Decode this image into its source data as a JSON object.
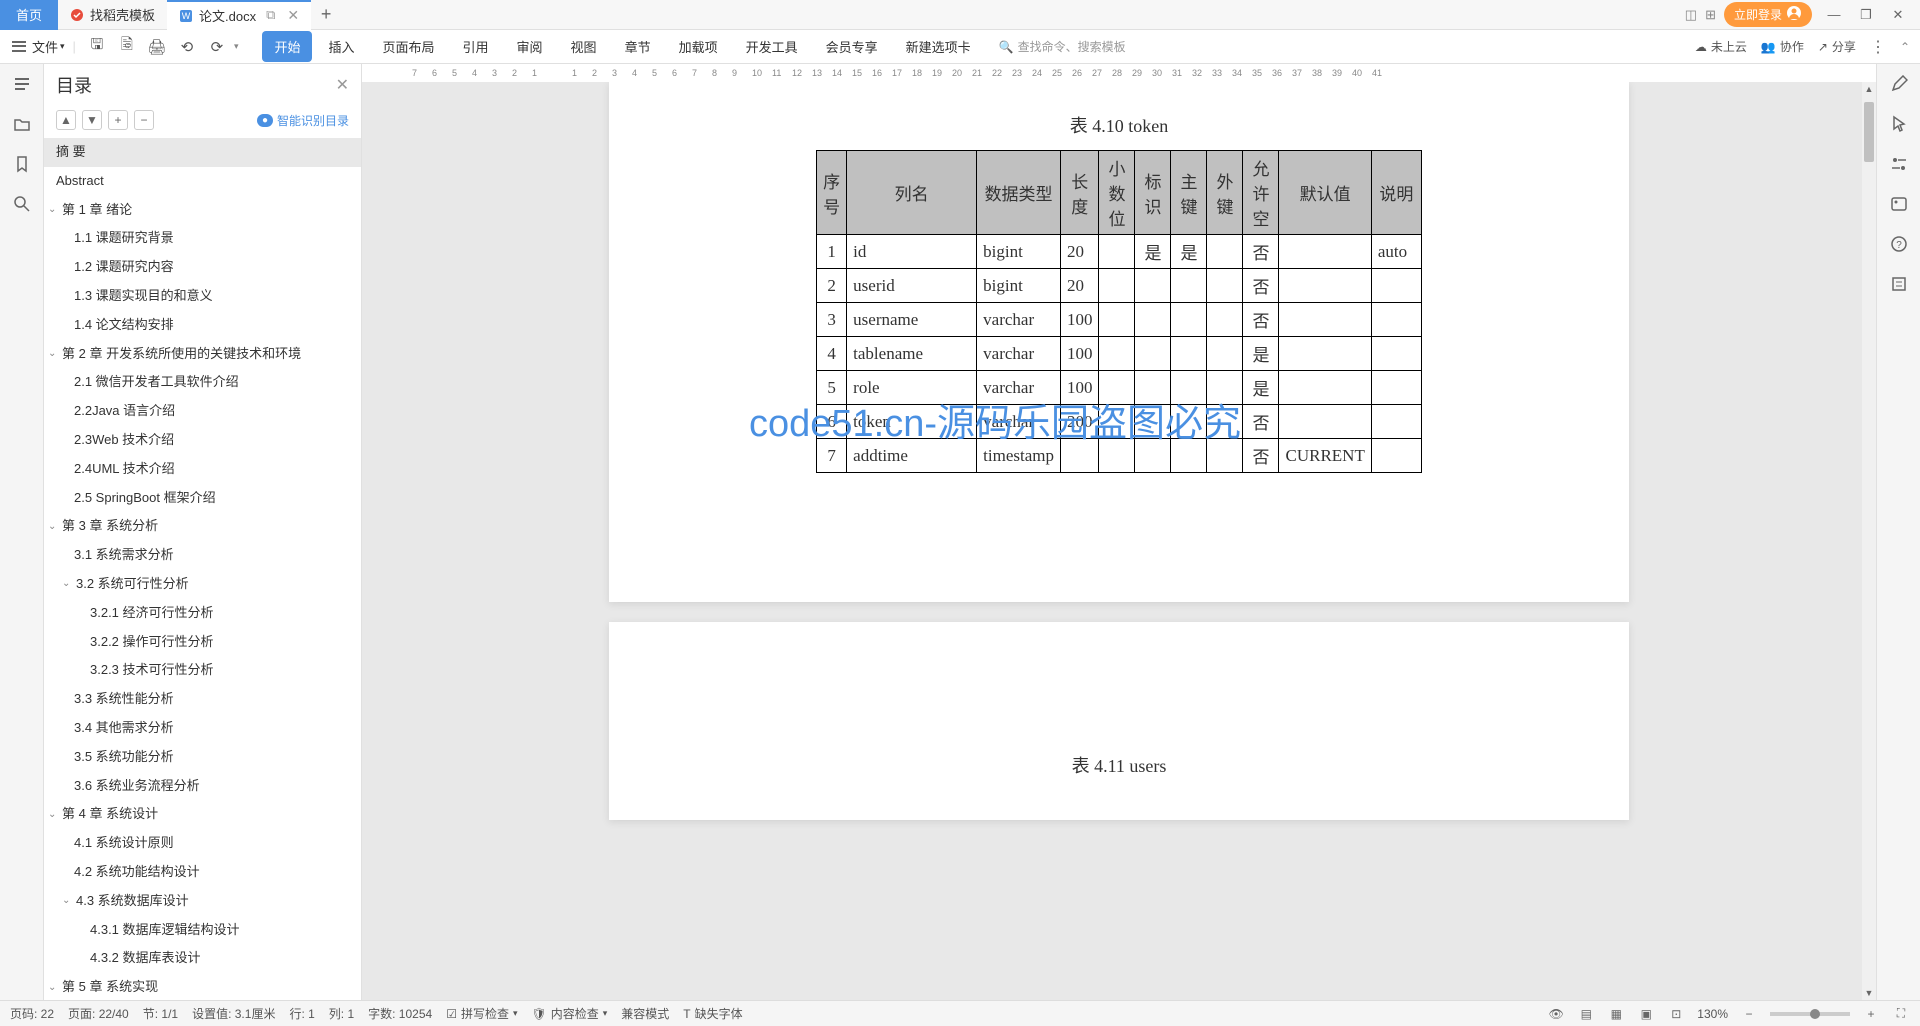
{
  "tabs": {
    "home": "首页",
    "template": "找稻壳模板",
    "document": "论文.docx"
  },
  "login_btn": "立即登录",
  "file_menu": "文件",
  "ribbon": {
    "start": "开始",
    "insert": "插入",
    "layout": "页面布局",
    "reference": "引用",
    "review": "审阅",
    "view": "视图",
    "chapter": "章节",
    "addon": "加载项",
    "devtools": "开发工具",
    "member": "会员专享",
    "newtab": "新建选项卡"
  },
  "search_placeholder": "查找命令、搜索模板",
  "toolbar_right": {
    "cloud": "未上云",
    "collab": "协作",
    "share": "分享"
  },
  "toc": {
    "title": "目录",
    "smart_label": "智能识别目录",
    "items": [
      {
        "level": 1,
        "label": "摘 要",
        "selected": true
      },
      {
        "level": 1,
        "label": "Abstract"
      },
      {
        "level": 1,
        "label": "第 1 章  绪论",
        "chevron": true
      },
      {
        "level": 2,
        "label": "1.1 课题研究背景"
      },
      {
        "level": 2,
        "label": "1.2 课题研究内容"
      },
      {
        "level": 2,
        "label": "1.3 课题实现目的和意义"
      },
      {
        "level": 2,
        "label": "1.4 论文结构安排"
      },
      {
        "level": 1,
        "label": "第 2 章  开发系统所使用的关键技术和环境",
        "chevron": true
      },
      {
        "level": 2,
        "label": "2.1 微信开发者工具软件介绍"
      },
      {
        "level": 2,
        "label": "2.2Java 语言介绍"
      },
      {
        "level": 2,
        "label": "2.3Web 技术介绍"
      },
      {
        "level": 2,
        "label": "2.4UML 技术介绍"
      },
      {
        "level": 2,
        "label": "2.5 SpringBoot 框架介绍"
      },
      {
        "level": 1,
        "label": "第 3 章  系统分析",
        "chevron": true
      },
      {
        "level": 2,
        "label": "3.1 系统需求分析"
      },
      {
        "level": 2,
        "label": "3.2 系统可行性分析",
        "chevron": true
      },
      {
        "level": 3,
        "label": "3.2.1 经济可行性分析"
      },
      {
        "level": 3,
        "label": "3.2.2 操作可行性分析"
      },
      {
        "level": 3,
        "label": "3.2.3 技术可行性分析"
      },
      {
        "level": 2,
        "label": "3.3 系统性能分析"
      },
      {
        "level": 2,
        "label": "3.4 其他需求分析"
      },
      {
        "level": 2,
        "label": "3.5 系统功能分析"
      },
      {
        "level": 2,
        "label": "3.6 系统业务流程分析"
      },
      {
        "level": 1,
        "label": "第 4 章  系统设计",
        "chevron": true
      },
      {
        "level": 2,
        "label": "4.1 系统设计原则"
      },
      {
        "level": 2,
        "label": "4.2 系统功能结构设计"
      },
      {
        "level": 2,
        "label": "4.3 系统数据库设计",
        "chevron": true
      },
      {
        "level": 3,
        "label": "4.3.1 数据库逻辑结构设计"
      },
      {
        "level": 3,
        "label": "4.3.2 数据库表设计"
      },
      {
        "level": 1,
        "label": "第 5 章  系统实现",
        "chevron": true
      }
    ]
  },
  "document": {
    "table_caption": "表 4.10 token",
    "table_caption2": "表 4.11 users",
    "headers": [
      "序号",
      "列名",
      "数据类型",
      "长度",
      "小数位",
      "标识",
      "主键",
      "外键",
      "允许空",
      "默认值",
      "说明"
    ],
    "rows": [
      [
        "1",
        "id",
        "bigint",
        "20",
        "",
        "是",
        "是",
        "",
        "否",
        "",
        "auto"
      ],
      [
        "2",
        "userid",
        "bigint",
        "20",
        "",
        "",
        "",
        "",
        "否",
        "",
        ""
      ],
      [
        "3",
        "username",
        "varchar",
        "100",
        "",
        "",
        "",
        "",
        "否",
        "",
        ""
      ],
      [
        "4",
        "tablename",
        "varchar",
        "100",
        "",
        "",
        "",
        "",
        "是",
        "",
        ""
      ],
      [
        "5",
        "role",
        "varchar",
        "100",
        "",
        "",
        "",
        "",
        "是",
        "",
        ""
      ],
      [
        "6",
        "token",
        "varchar",
        "200",
        "",
        "",
        "",
        "",
        "否",
        "",
        ""
      ],
      [
        "7",
        "addtime",
        "timestamp",
        "",
        "",
        "",
        "",
        "",
        "否",
        "CURRENT",
        ""
      ]
    ],
    "watermark": "code51.cn-源码乐园盗图必究"
  },
  "ruler": [
    "7",
    "6",
    "5",
    "4",
    "3",
    "2",
    "1",
    "",
    "1",
    "2",
    "3",
    "4",
    "5",
    "6",
    "7",
    "8",
    "9",
    "10",
    "11",
    "12",
    "13",
    "14",
    "15",
    "16",
    "17",
    "18",
    "19",
    "20",
    "21",
    "22",
    "23",
    "24",
    "25",
    "26",
    "27",
    "28",
    "29",
    "30",
    "31",
    "32",
    "33",
    "34",
    "35",
    "36",
    "37",
    "38",
    "39",
    "40",
    "41"
  ],
  "statusbar": {
    "page": "页码: 22",
    "pages": "页面: 22/40",
    "section": "节: 1/1",
    "setting": "设置值: 3.1厘米",
    "row": "行: 1",
    "col": "列: 1",
    "words": "字数: 10254",
    "spell": "拼写检查",
    "content": "内容检查",
    "compat": "兼容模式",
    "font": "缺失字体",
    "zoom": "130%"
  }
}
